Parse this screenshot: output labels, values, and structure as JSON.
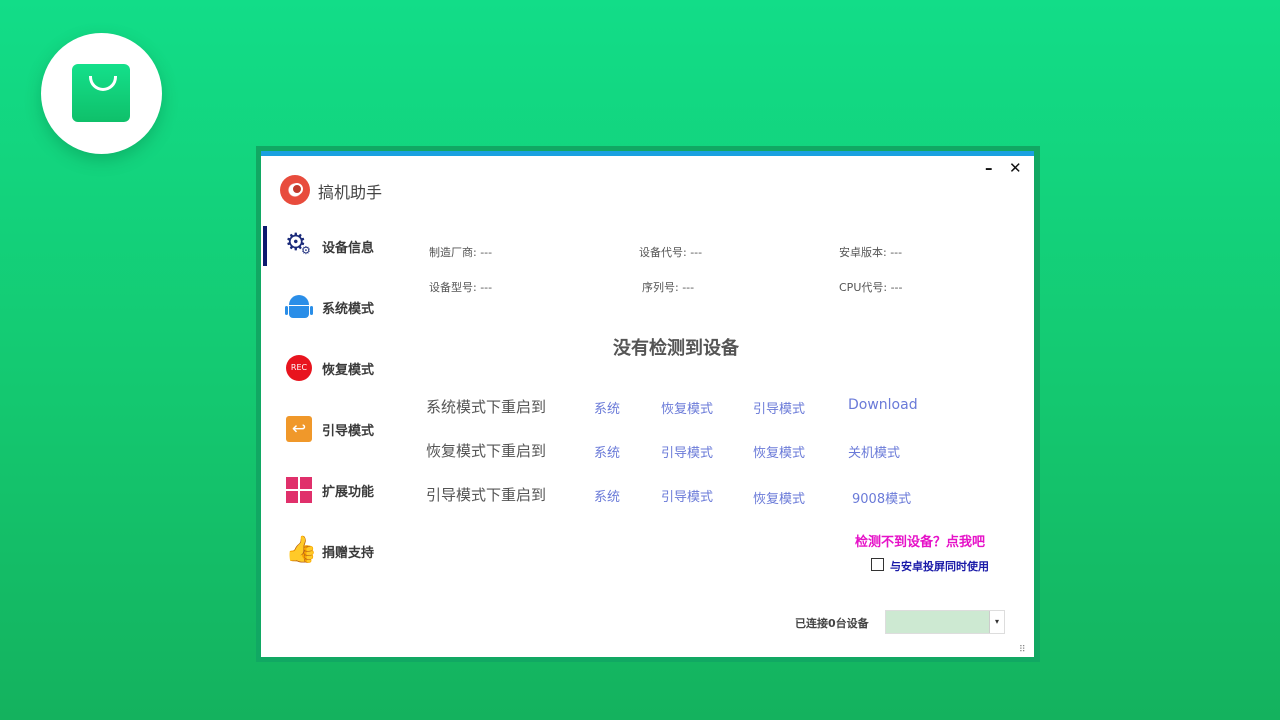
{
  "window": {
    "title": "搞机助手",
    "minimize": "–",
    "close": "✕"
  },
  "sidebar": {
    "items": [
      {
        "label": "设备信息",
        "icon": "gear-icon"
      },
      {
        "label": "系统模式",
        "icon": "android-icon"
      },
      {
        "label": "恢复模式",
        "icon": "rec-icon"
      },
      {
        "label": "引导模式",
        "icon": "back-arrow-icon"
      },
      {
        "label": "扩展功能",
        "icon": "grid-icon"
      },
      {
        "label": "捐赠支持",
        "icon": "thumbs-up-icon"
      }
    ],
    "rec_text": "REC"
  },
  "device_info": {
    "manufacturer": "制造厂商: ---",
    "device_code": "设备代号: ---",
    "android_version": "安卓版本: ---",
    "model": "设备型号: ---",
    "serial": "序列号: ---",
    "cpu_code": "CPU代号: ---"
  },
  "headline": "没有检测到设备",
  "reboot_rows": [
    {
      "label": "系统模式下重启到",
      "options": [
        "系统",
        "恢复模式",
        "引导模式",
        "Download"
      ]
    },
    {
      "label": "恢复模式下重启到",
      "options": [
        "系统",
        "引导模式",
        "恢复模式",
        "关机模式"
      ]
    },
    {
      "label": "引导模式下重启到",
      "options": [
        "系统",
        "引导模式",
        "恢复模式",
        "9008模式"
      ]
    }
  ],
  "help_link": "检测不到设备？点我吧",
  "cast_checkbox_label": "与安卓投屏同时使用",
  "status": "已连接0台设备",
  "device_select": {
    "value": "",
    "arrow": "▾"
  },
  "colors": {
    "background": "#12dd88",
    "accent": "#1aa0e0",
    "link": "#6a7ad8",
    "help": "#e612c8"
  }
}
